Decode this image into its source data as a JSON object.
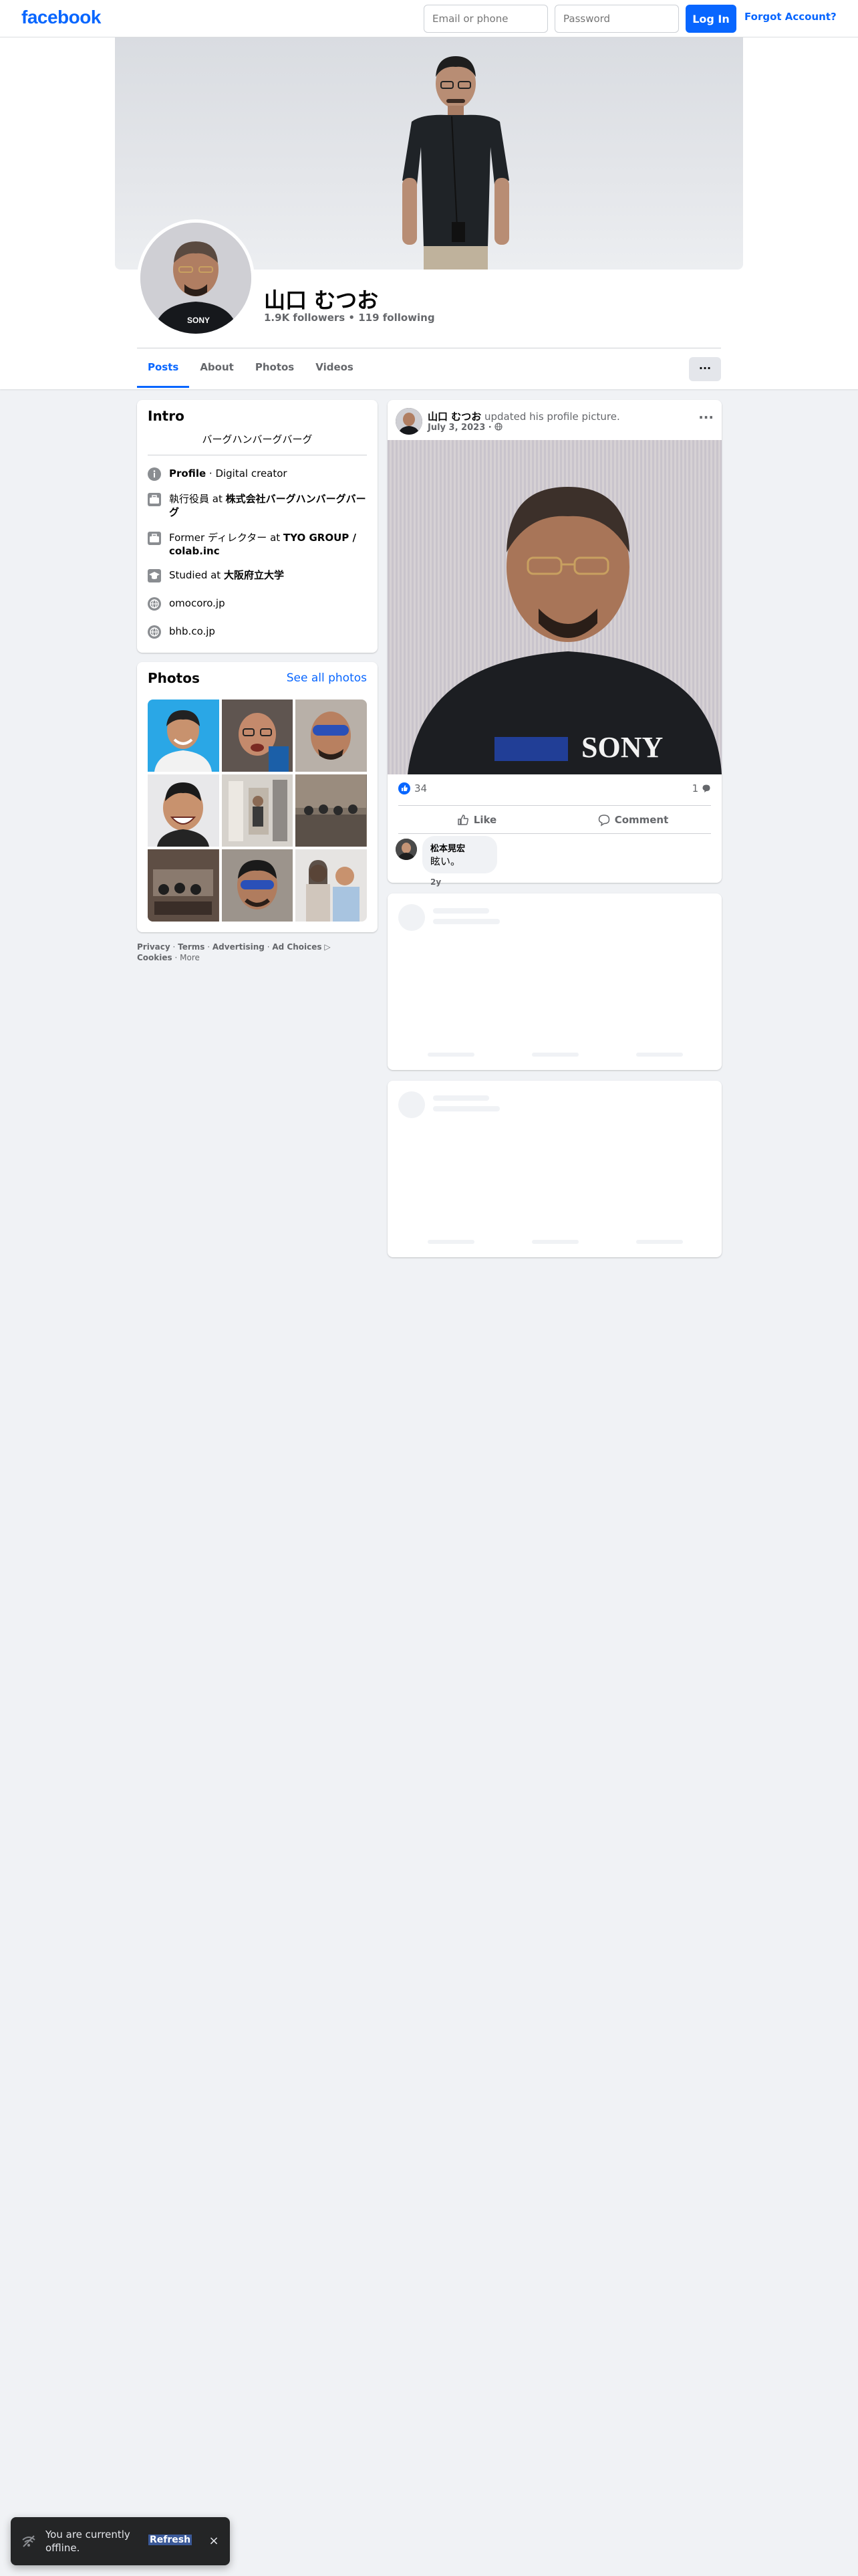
{
  "header": {
    "logo": "facebook",
    "email_placeholder": "Email or phone",
    "password_placeholder": "Password",
    "login_label": "Log In",
    "forgot_label": "Forgot Account?"
  },
  "profile": {
    "name": "山口 むつお",
    "stats": "1.9K followers • 119 following",
    "tabs": [
      "Posts",
      "About",
      "Photos",
      "Videos"
    ],
    "more_label": "···"
  },
  "intro": {
    "title": "Intro",
    "bio": "バーグハンバーグバーグ",
    "items": [
      {
        "icon": "info-icon",
        "bold": "Profile",
        "text": " · Digital creator"
      },
      {
        "icon": "briefcase-icon",
        "prefix": "執行役員 at ",
        "bold": "株式会社バーグハンバーグバーグ"
      },
      {
        "icon": "briefcase-icon",
        "prefix": "Former ディレクター at ",
        "bold": "TYO GROUP / colab.inc"
      },
      {
        "icon": "graduation-cap-icon",
        "prefix": "Studied at ",
        "bold": "大阪府立大学"
      },
      {
        "icon": "globe-icon",
        "text": "omocoro.jp"
      },
      {
        "icon": "globe-icon",
        "text": "bhb.co.jp"
      }
    ]
  },
  "photos": {
    "title": "Photos",
    "see_all": "See all photos"
  },
  "footer": {
    "privacy": "Privacy",
    "terms": "Terms",
    "advertising": "Advertising",
    "ad_choices": "Ad Choices",
    "cookies": "Cookies",
    "more": "More"
  },
  "post": {
    "author": "山口 むつお",
    "action": " updated his profile picture.",
    "date": "July 3, 2023 · ",
    "like_count": "34",
    "comment_count": "1",
    "like_label": "Like",
    "comment_label": "Comment",
    "comment": {
      "name": "松本晃宏",
      "text": "眩い。",
      "time": "2y"
    },
    "shirt_text": "SONY"
  },
  "toast": {
    "text": "You are currently offline.",
    "refresh_label": "Refresh",
    "close_label": "×"
  },
  "colors": {
    "brand": "#0866ff",
    "background": "#f0f2f5"
  }
}
